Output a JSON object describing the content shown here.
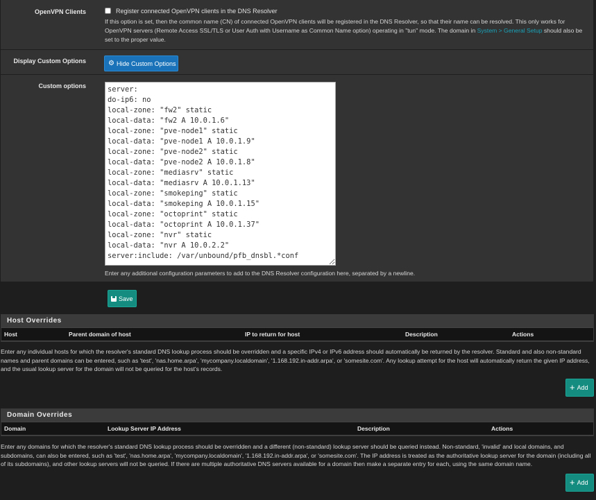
{
  "openvpn": {
    "label": "OpenVPN Clients",
    "checkbox_label": "Register connected OpenVPN clients in the DNS Resolver",
    "help_pre": "If this option is set, then the common name (CN) of connected OpenVPN clients will be registered in the DNS Resolver, so that their name can be resolved. This only works for OpenVPN servers (Remote Access SSL/TLS or User Auth with Username as Common Name option) operating in \"tun\" mode. The domain in ",
    "help_link": "System > General Setup",
    "help_post": " should also be set to the proper value."
  },
  "display_custom": {
    "label": "Display Custom Options",
    "button": "Hide Custom Options",
    "icon": "gear-icon"
  },
  "custom_options": {
    "label": "Custom options",
    "value": "server:\ndo-ip6: no\nlocal-zone: \"fw2\" static\nlocal-data: \"fw2 A 10.0.1.6\"\nlocal-zone: \"pve-node1\" static\nlocal-data: \"pve-node1 A 10.0.1.9\"\nlocal-zone: \"pve-node2\" static\nlocal-data: \"pve-node2 A 10.0.1.8\"\nlocal-zone: \"mediasrv\" static\nlocal-data: \"mediasrv A 10.0.1.13\"\nlocal-zone: \"smokeping\" static\nlocal-data: \"smokeping A 10.0.1.15\"\nlocal-zone: \"octoprint\" static\nlocal-data: \"octoprint A 10.0.1.37\"\nlocal-zone: \"nvr\" static\nlocal-data: \"nvr A 10.0.2.2\"\nserver:include: /var/unbound/pfb_dnsbl.*conf",
    "help": "Enter any additional configuration parameters to add to the DNS Resolver configuration here, separated by a newline."
  },
  "save_button": "Save",
  "host_overrides": {
    "title": "Host Overrides",
    "columns": [
      "Host",
      "Parent domain of host",
      "IP to return for host",
      "Description",
      "Actions"
    ],
    "help": "Enter any individual hosts for which the resolver's standard DNS lookup process should be overridden and a specific IPv4 or IPv6 address should automatically be returned by the resolver. Standard and also non-standard names and parent domains can be entered, such as 'test', 'nas.home.arpa', 'mycompany.localdomain', '1.168.192.in-addr.arpa', or 'somesite.com'. Any lookup attempt for the host will automatically return the given IP address, and the usual lookup server for the domain will not be queried for the host's records.",
    "add_button": "Add"
  },
  "domain_overrides": {
    "title": "Domain Overrides",
    "columns": [
      "Domain",
      "Lookup Server IP Address",
      "Description",
      "Actions"
    ],
    "help": "Enter any domains for which the resolver's standard DNS lookup process should be overridden and a different (non-standard) lookup server should be queried instead. Non-standard, 'invalid' and local domains, and subdomains, can also be entered, such as 'test', 'nas.home.arpa', 'mycompany.localdomain', '1.168.192.in-addr.arpa', or 'somesite.com'. The IP address is treated as the authoritative lookup server for the domain (including all of its subdomains), and other lookup servers will not be queried. If there are multiple authoritative DNS servers available for a domain then make a separate entry for each, using the same domain name.",
    "add_button": "Add"
  }
}
